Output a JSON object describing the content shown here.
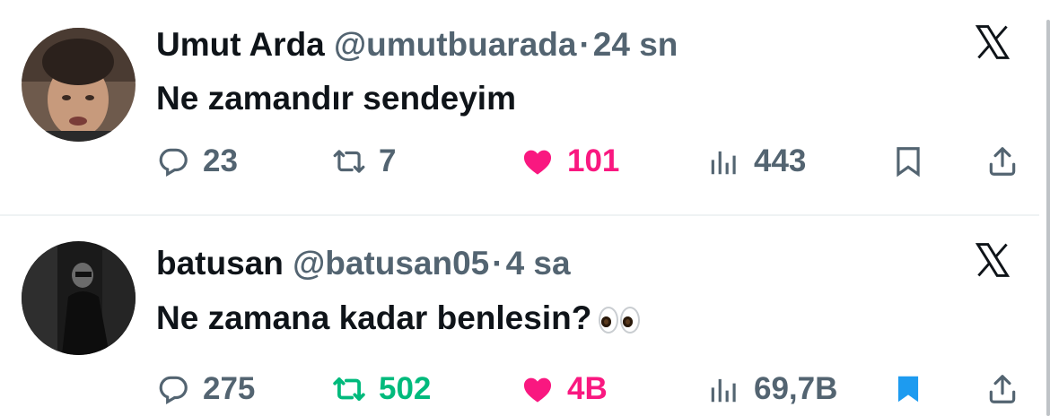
{
  "tweets": [
    {
      "name": "Umut Arda",
      "handle": "@umutbuarada",
      "dot": "·",
      "time": "24 sn",
      "text": "Ne zamandır sendeyim",
      "emoji": "",
      "reply_count": "23",
      "retweet_count": "7",
      "like_count": "101",
      "view_count": "443",
      "liked": true,
      "retweeted": false,
      "bookmarked": false
    },
    {
      "name": "batusan",
      "handle": "@batusan05",
      "dot": "·",
      "time": "4 sa",
      "text": "Ne zamana kadar benlesin?",
      "emoji": "eyes",
      "reply_count": "275",
      "retweet_count": "502",
      "like_count": "4B",
      "view_count": "69,7B",
      "liked": true,
      "retweeted": true,
      "bookmarked": true
    }
  ],
  "colors": {
    "like": "#f91880",
    "retweet": "#00ba7c",
    "bookmark": "#1d9bf0",
    "muted": "#536471",
    "text": "#0f1419"
  },
  "icons": [
    "reply-icon",
    "retweet-icon",
    "heart-icon",
    "views-icon",
    "bookmark-icon",
    "share-icon",
    "x-logo-icon"
  ]
}
